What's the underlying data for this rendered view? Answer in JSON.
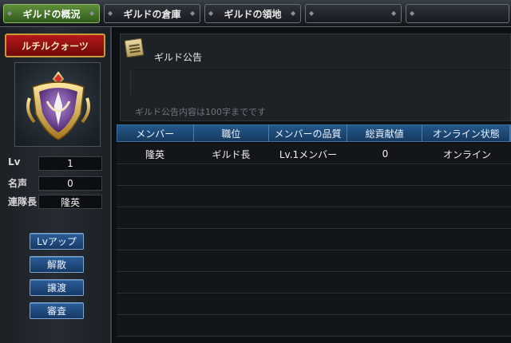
{
  "tabs": [
    {
      "label": "ギルドの概況",
      "active": true
    },
    {
      "label": "ギルドの倉庫",
      "active": false
    },
    {
      "label": "ギルドの領地",
      "active": false
    },
    {
      "label": "",
      "active": false
    },
    {
      "label": "",
      "active": false
    }
  ],
  "guild": {
    "name": "ルチルクォーツ",
    "stats": [
      {
        "label": "Lv",
        "value": "1"
      },
      {
        "label": "名声",
        "value": "0"
      },
      {
        "label": "連隊長",
        "value": "隆英"
      }
    ],
    "buttons": [
      "Lvアップ",
      "解散",
      "譲渡",
      "審査"
    ]
  },
  "notice": {
    "title": "ギルド公告",
    "hint": "ギルド公告内容は100字までです"
  },
  "members": {
    "columns": [
      "メンバー",
      "職位",
      "メンバーの品質",
      "総貢献値",
      "オンライン状態"
    ],
    "rows": [
      [
        "隆英",
        "ギルド長",
        "Lv.1メンバー",
        "0",
        "オンライン"
      ],
      [
        "",
        "",
        "",
        "",
        ""
      ],
      [
        "",
        "",
        "",
        "",
        ""
      ],
      [
        "",
        "",
        "",
        "",
        ""
      ],
      [
        "",
        "",
        "",
        "",
        ""
      ],
      [
        "",
        "",
        "",
        "",
        ""
      ],
      [
        "",
        "",
        "",
        "",
        ""
      ],
      [
        "",
        "",
        "",
        "",
        ""
      ],
      [
        "",
        "",
        "",
        "",
        ""
      ]
    ]
  },
  "colors": {
    "accent_blue": "#24588c",
    "tab_active": "#5f8f3a",
    "banner_red": "#b51818"
  },
  "icons": {
    "emblem": "guild-emblem-icon",
    "notice": "notice-scroll-icon"
  }
}
